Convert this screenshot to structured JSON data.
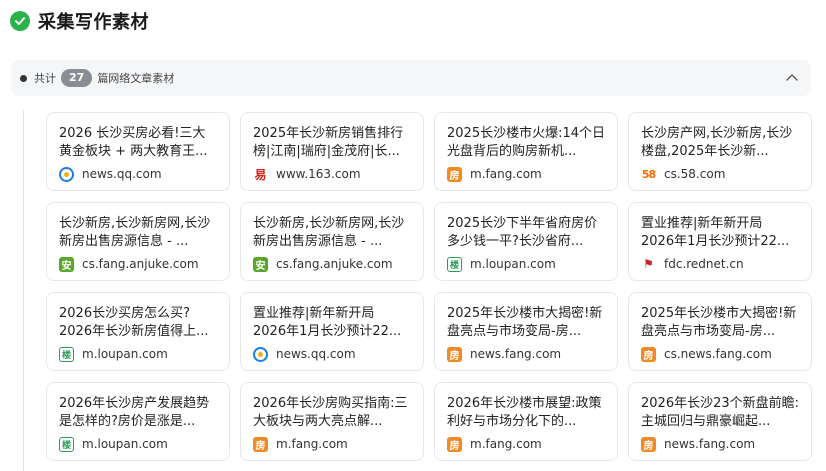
{
  "header": {
    "title": "采集写作素材",
    "check_icon": "check-circle-icon",
    "check_color": "#2bb24c"
  },
  "summary": {
    "prefix": "共计",
    "count": "27",
    "suffix": "篇网络文章素材",
    "toggle_icon": "chevron-up-icon"
  },
  "cards": [
    {
      "title": "2026 长沙买房必看!三大黄金板块 + 两大教育王...",
      "source": "news.qq.com",
      "icon": "qq"
    },
    {
      "title": "2025年长沙新房销售排行榜|江南|瑞府|金茂府|长...",
      "source": "www.163.com",
      "icon": "n163"
    },
    {
      "title": "2025长沙楼市火爆:14个日光盘背后的购房新机...",
      "source": "m.fang.com",
      "icon": "fang"
    },
    {
      "title": "长沙房产网,长沙新房,长沙楼盘,2025年长沙新...",
      "source": "cs.58.com",
      "icon": "f58"
    },
    {
      "title": "长沙新房,长沙新房网,长沙新房出售房源信息 - ...",
      "source": "cs.fang.anjuke.com",
      "icon": "anjuke"
    },
    {
      "title": "长沙新房,长沙新房网,长沙新房出售房源信息 - ...",
      "source": "cs.fang.anjuke.com",
      "icon": "anjuke"
    },
    {
      "title": "2025长沙下半年省府房价多少钱一平?长沙省府...",
      "source": "m.loupan.com",
      "icon": "loupan"
    },
    {
      "title": "置业推荐|新年新开局 2026年1月长沙预计22...",
      "source": "fdc.rednet.cn",
      "icon": "rednet"
    },
    {
      "title": "2026长沙买房怎么买? 2026年长沙新房值得上...",
      "source": "m.loupan.com",
      "icon": "loupan"
    },
    {
      "title": "置业推荐|新年新开局 2026年1月长沙预计22...",
      "source": "news.qq.com",
      "icon": "qq"
    },
    {
      "title": "2025年长沙楼市大揭密!新盘亮点与市场变局-房...",
      "source": "news.fang.com",
      "icon": "fang"
    },
    {
      "title": "2025年长沙楼市大揭密!新盘亮点与市场变局-房...",
      "source": "cs.news.fang.com",
      "icon": "fang"
    },
    {
      "title": "2026年长沙房产发展趋势是怎样的?房价是涨是...",
      "source": "m.loupan.com",
      "icon": "loupan"
    },
    {
      "title": "2026年长沙房购买指南:三大板块与两大亮点解...",
      "source": "m.fang.com",
      "icon": "fang"
    },
    {
      "title": "2026年长沙楼市展望:政策利好与市场分化下的...",
      "source": "m.fang.com",
      "icon": "fang"
    },
    {
      "title": "2026年长沙23个新盘前瞻:主城回归与鼎豪崛起...",
      "source": "news.fang.com",
      "icon": "fang"
    }
  ],
  "icon_glyphs": {
    "qq": "",
    "n163": "易",
    "fang": "房",
    "f58": "58",
    "anjuke": "安",
    "loupan": "楼",
    "rednet": "⚑"
  }
}
